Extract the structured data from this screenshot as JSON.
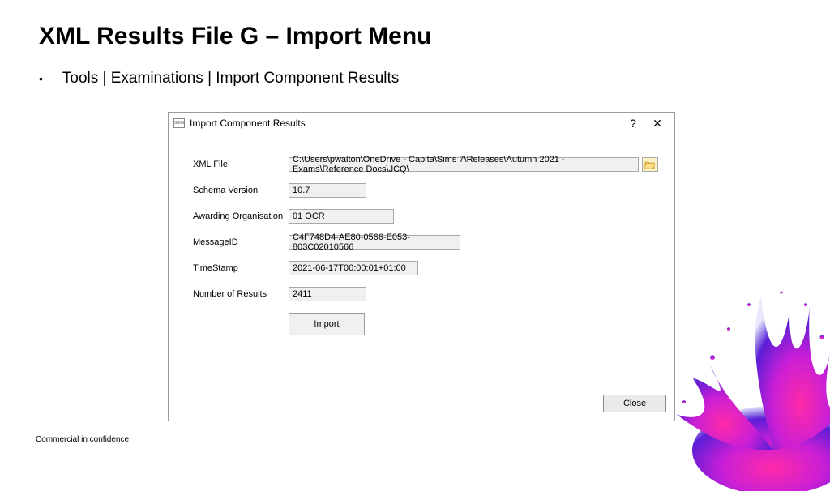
{
  "title": "XML Results File G – Import Menu",
  "breadcrumb": "Tools | Examinations | Import Component Results",
  "footer": "Commercial in confidence",
  "dialog": {
    "app_icon_text": "SIMS",
    "title": "Import Component Results",
    "labels": {
      "xml_file": "XML File",
      "schema": "Schema Version",
      "award": "Awarding Organisation",
      "msgid": "MessageID",
      "timestamp": "TimeStamp",
      "count": "Number of Results"
    },
    "values": {
      "xml_file": "C:\\Users\\pwalton\\OneDrive - Capita\\Sims 7\\Releases\\Autumn 2021 - Exams\\Reference Docs\\JCQ\\",
      "schema": "10.7",
      "award": "01 OCR",
      "msgid": "C4F748D4-AE80-0566-E053-803C02010566",
      "timestamp": "2021-06-17T00:00:01+01:00",
      "count": "2411"
    },
    "buttons": {
      "import": "Import",
      "close": "Close"
    }
  }
}
